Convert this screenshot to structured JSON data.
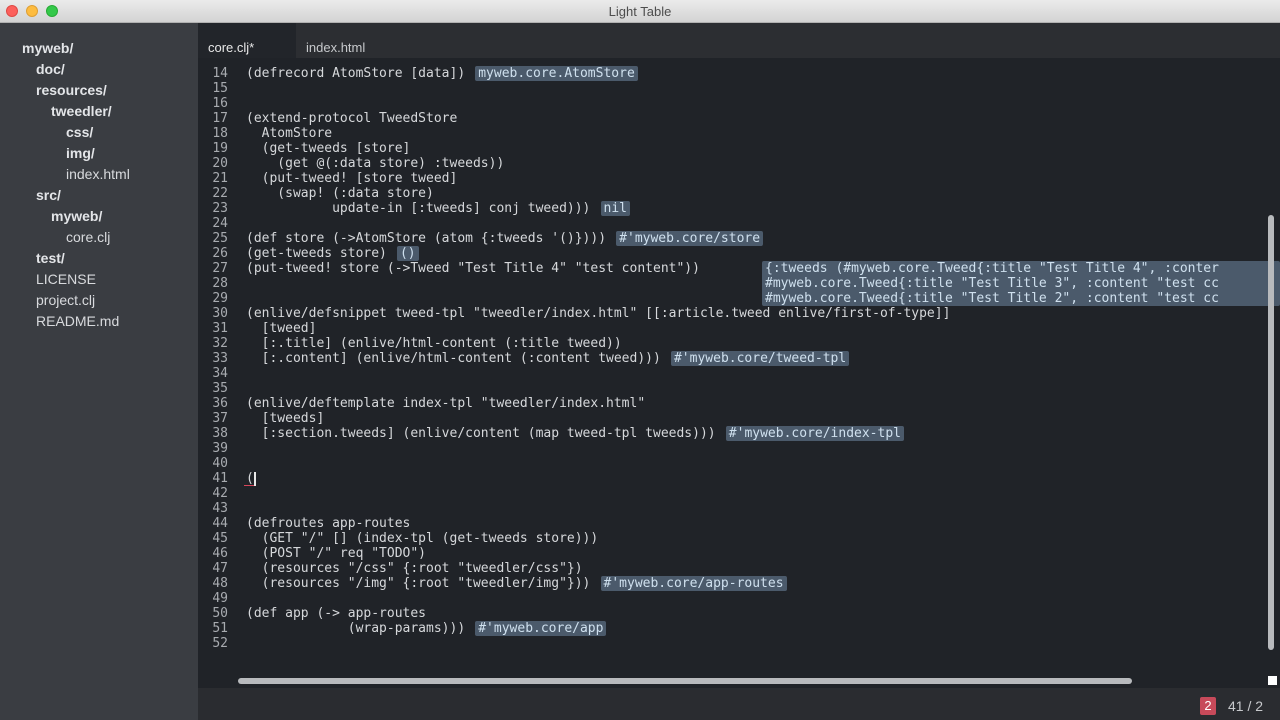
{
  "window": {
    "title": "Light Table"
  },
  "sidebar": {
    "items": [
      {
        "label": "myweb/",
        "type": "folder"
      },
      {
        "label": "doc/",
        "type": "folder"
      },
      {
        "label": "resources/",
        "type": "folder"
      },
      {
        "label": "tweedler/",
        "type": "folder"
      },
      {
        "label": "css/",
        "type": "folder"
      },
      {
        "label": "img/",
        "type": "folder"
      },
      {
        "label": "index.html",
        "type": "file"
      },
      {
        "label": "src/",
        "type": "folder"
      },
      {
        "label": "myweb/",
        "type": "folder"
      },
      {
        "label": "core.clj",
        "type": "file"
      },
      {
        "label": "test/",
        "type": "folder"
      },
      {
        "label": "LICENSE",
        "type": "file"
      },
      {
        "label": "project.clj",
        "type": "file"
      },
      {
        "label": "README.md",
        "type": "file"
      }
    ]
  },
  "tabs": [
    {
      "label": "core.clj*",
      "active": true
    },
    {
      "label": "index.html",
      "active": false
    }
  ],
  "editor": {
    "lines": [
      {
        "n": "14",
        "code": "(defrecord AtomStore [data])"
      },
      {
        "n": "15",
        "code": ""
      },
      {
        "n": "16",
        "code": ""
      },
      {
        "n": "17",
        "code": "(extend-protocol TweedStore"
      },
      {
        "n": "18",
        "code": "  AtomStore"
      },
      {
        "n": "19",
        "code": "  (get-tweeds [store]"
      },
      {
        "n": "20",
        "code": "    (get @(:data store) :tweeds))"
      },
      {
        "n": "21",
        "code": "  (put-tweed! [store tweed]"
      },
      {
        "n": "22",
        "code": "    (swap! (:data store)"
      },
      {
        "n": "23",
        "code": "           update-in [:tweeds] conj tweed)))"
      },
      {
        "n": "24",
        "code": ""
      },
      {
        "n": "25",
        "code": "(def store (->AtomStore (atom {:tweeds '()})))"
      },
      {
        "n": "26",
        "code": "(get-tweeds store)"
      },
      {
        "n": "27",
        "code": "(put-tweed! store (->Tweed \"Test Title 4\" \"test content\"))"
      },
      {
        "n": "28",
        "code": ""
      },
      {
        "n": "29",
        "code": ""
      },
      {
        "n": "30",
        "code": "(enlive/defsnippet tweed-tpl \"tweedler/index.html\" [[:article.tweed enlive/first-of-type]]"
      },
      {
        "n": "31",
        "code": "  [tweed]"
      },
      {
        "n": "32",
        "code": "  [:.title] (enlive/html-content (:title tweed))"
      },
      {
        "n": "33",
        "code": "  [:.content] (enlive/html-content (:content tweed)))"
      },
      {
        "n": "34",
        "code": ""
      },
      {
        "n": "35",
        "code": ""
      },
      {
        "n": "36",
        "code": "(enlive/deftemplate index-tpl \"tweedler/index.html\""
      },
      {
        "n": "37",
        "code": "  [tweeds]"
      },
      {
        "n": "38",
        "code": "  [:section.tweeds] (enlive/content (map tweed-tpl tweeds)))"
      },
      {
        "n": "39",
        "code": ""
      },
      {
        "n": "40",
        "code": ""
      },
      {
        "n": "41",
        "code": "("
      },
      {
        "n": "42",
        "code": ""
      },
      {
        "n": "43",
        "code": ""
      },
      {
        "n": "44",
        "code": "(defroutes app-routes"
      },
      {
        "n": "45",
        "code": "  (GET \"/\" [] (index-tpl (get-tweeds store)))"
      },
      {
        "n": "46",
        "code": "  (POST \"/\" req \"TODO\")"
      },
      {
        "n": "47",
        "code": "  (resources \"/css\" {:root \"tweedler/css\"})"
      },
      {
        "n": "48",
        "code": "  (resources \"/img\" {:root \"tweedler/img\"}))"
      },
      {
        "n": "49",
        "code": ""
      },
      {
        "n": "50",
        "code": "(def app (-> app-routes"
      },
      {
        "n": "51",
        "code": "             (wrap-params)))"
      },
      {
        "n": "52",
        "code": ""
      }
    ],
    "results": [
      {
        "line": "14",
        "text": "myweb.core.AtomStore"
      },
      {
        "line": "23",
        "text": "nil"
      },
      {
        "line": "25",
        "text": "#'myweb.core/store"
      },
      {
        "line": "26",
        "text": "()"
      },
      {
        "line": "27",
        "text": "{:tweeds (#myweb.core.Tweed{:title \"Test Title 4\", :conter\n#myweb.core.Tweed{:title \"Test Title 3\", :content \"test cc\n#myweb.core.Tweed{:title \"Test Title 2\", :content \"test cc"
      },
      {
        "line": "33",
        "text": "#'myweb.core/tweed-tpl"
      },
      {
        "line": "38",
        "text": "#'myweb.core/index-tpl"
      },
      {
        "line": "48",
        "text": "#'myweb.core/app-routes"
      },
      {
        "line": "51",
        "text": "#'myweb.core/app"
      }
    ]
  },
  "statusbar": {
    "error_count": "2",
    "cursor_position": "41 / 2"
  }
}
